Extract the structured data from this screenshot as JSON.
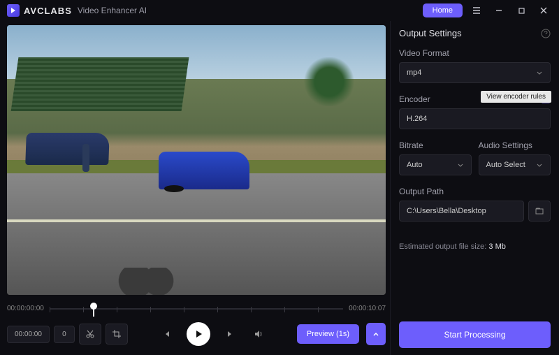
{
  "titlebar": {
    "brand": "AVCLABS",
    "subtitle": "Video Enhancer AI",
    "home": "Home"
  },
  "timeline": {
    "start": "00:00:00:00",
    "end": "00:00:10:07"
  },
  "controls": {
    "timecode": "00:00:00",
    "frame": "0",
    "preview": "Preview (1s)"
  },
  "panel": {
    "title": "Output Settings",
    "format_label": "Video Format",
    "format_value": "mp4",
    "encoder_label": "Encoder",
    "encoder_value": "H.264",
    "encoder_tooltip": "View encoder rules",
    "bitrate_label": "Bitrate",
    "bitrate_value": "Auto",
    "audio_label": "Audio Settings",
    "audio_value": "Auto Select",
    "path_label": "Output Path",
    "path_value": "C:\\Users\\Bella\\Desktop",
    "est_prefix": "Estimated output file size: ",
    "est_value": "3 Mb",
    "start": "Start Processing"
  }
}
